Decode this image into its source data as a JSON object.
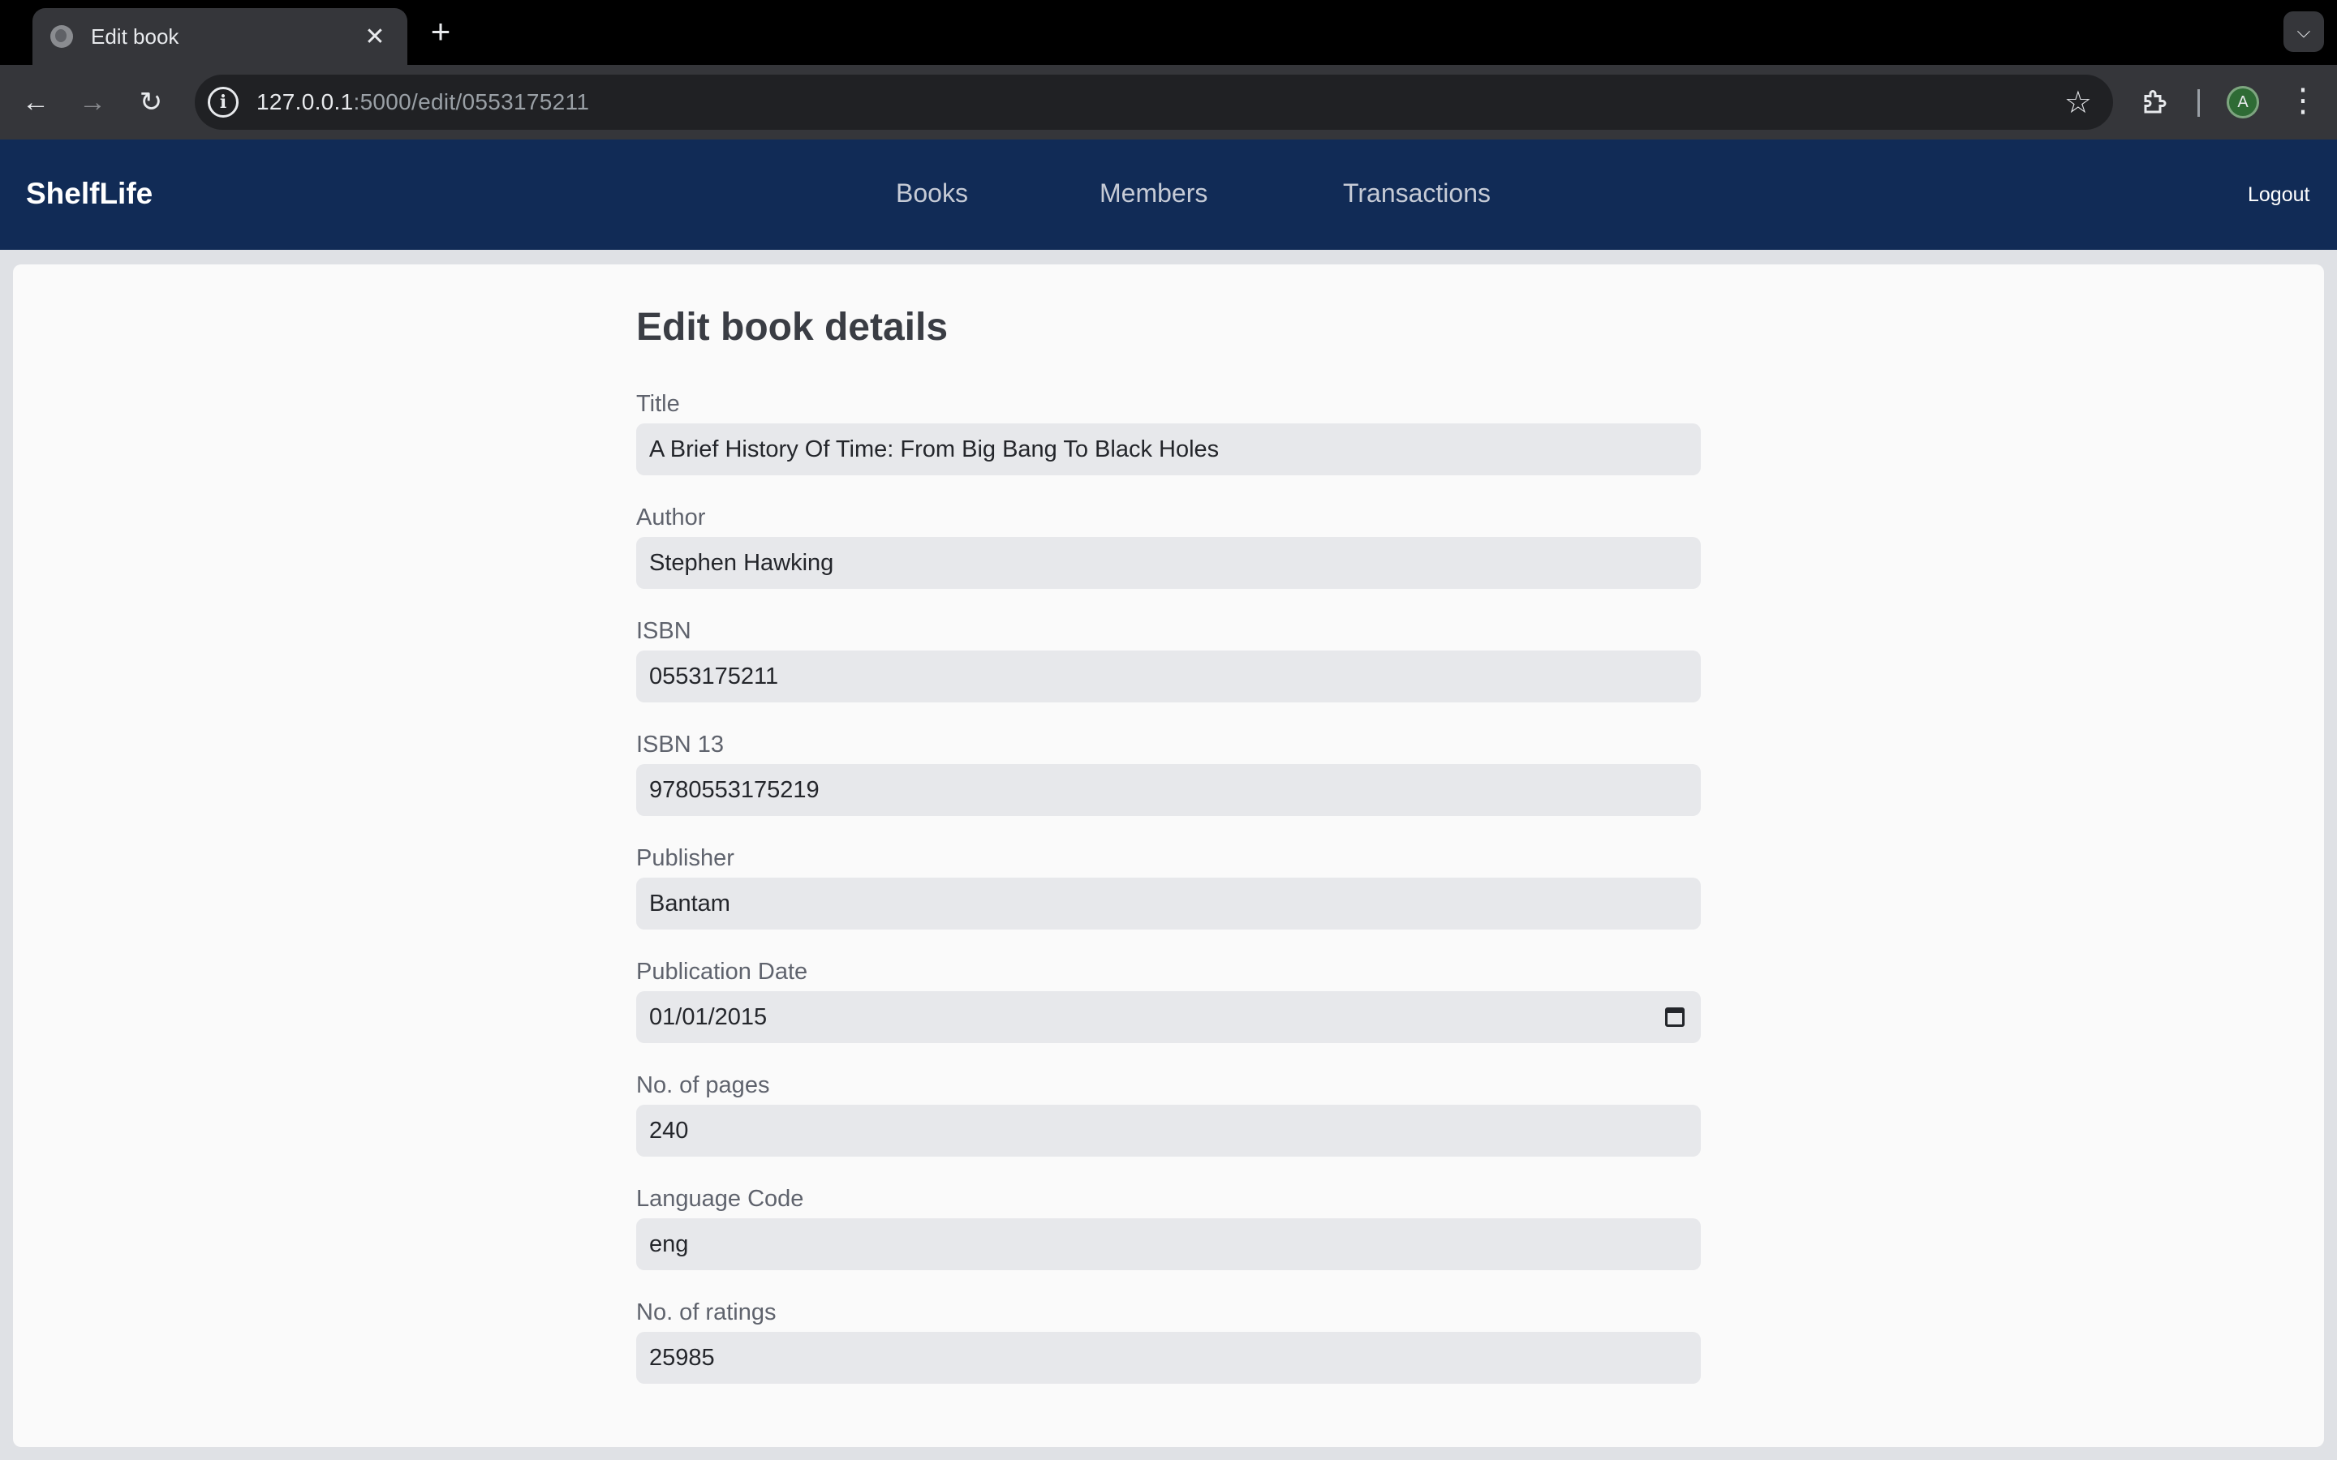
{
  "browser": {
    "tab_title": "Edit book",
    "tab_close": "✕",
    "new_tab": "+",
    "url_host": "127.0.0.1",
    "url_rest": ":5000/edit/0553175211",
    "profile_initial": "A"
  },
  "nav": {
    "brand": "ShelfLife",
    "links": [
      "Books",
      "Members",
      "Transactions"
    ],
    "logout": "Logout"
  },
  "page": {
    "title": "Edit book details"
  },
  "form": {
    "fields": [
      {
        "label": "Title",
        "value": "A Brief History Of Time: From Big Bang To Black Holes"
      },
      {
        "label": "Author",
        "value": "Stephen Hawking"
      },
      {
        "label": "ISBN",
        "value": "0553175211"
      },
      {
        "label": "ISBN 13",
        "value": "9780553175219"
      },
      {
        "label": "Publisher",
        "value": "Bantam"
      },
      {
        "label": "Publication Date",
        "value": "01/01/2015"
      },
      {
        "label": "No. of pages",
        "value": "240"
      },
      {
        "label": "Language Code",
        "value": "eng"
      },
      {
        "label": "No. of ratings",
        "value": "25985"
      }
    ]
  }
}
